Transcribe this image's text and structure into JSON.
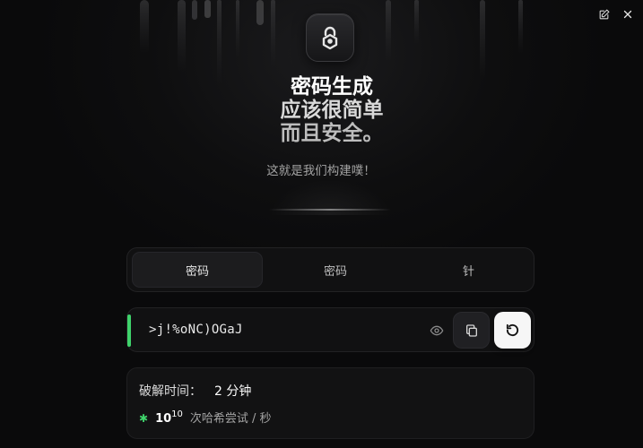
{
  "window": {
    "edit_icon": "edit-square-icon",
    "close_icon": "close-icon"
  },
  "logo": {
    "icon": "padlock-icon"
  },
  "hero": {
    "line1": "密码生成",
    "line2": "应该很简单",
    "line3": "而且安全。",
    "subtitle": "这就是我们构建噗！"
  },
  "tabs": [
    {
      "label": "密码",
      "active": true
    },
    {
      "label": "密码",
      "active": false
    },
    {
      "label": "针",
      "active": false
    }
  ],
  "password": {
    "value": ">j!%oNC)OGaJ",
    "strength_color": "#3fd36b"
  },
  "stats": {
    "crack_label": "破解时间：",
    "crack_value": "2 分钟",
    "rate_base": "10",
    "rate_exponent": "10",
    "rate_unit": "次哈希尝试 / 秒"
  },
  "colors": {
    "background": "#0b0b0c",
    "accent_green": "#3fd36b",
    "card": "#111112"
  }
}
